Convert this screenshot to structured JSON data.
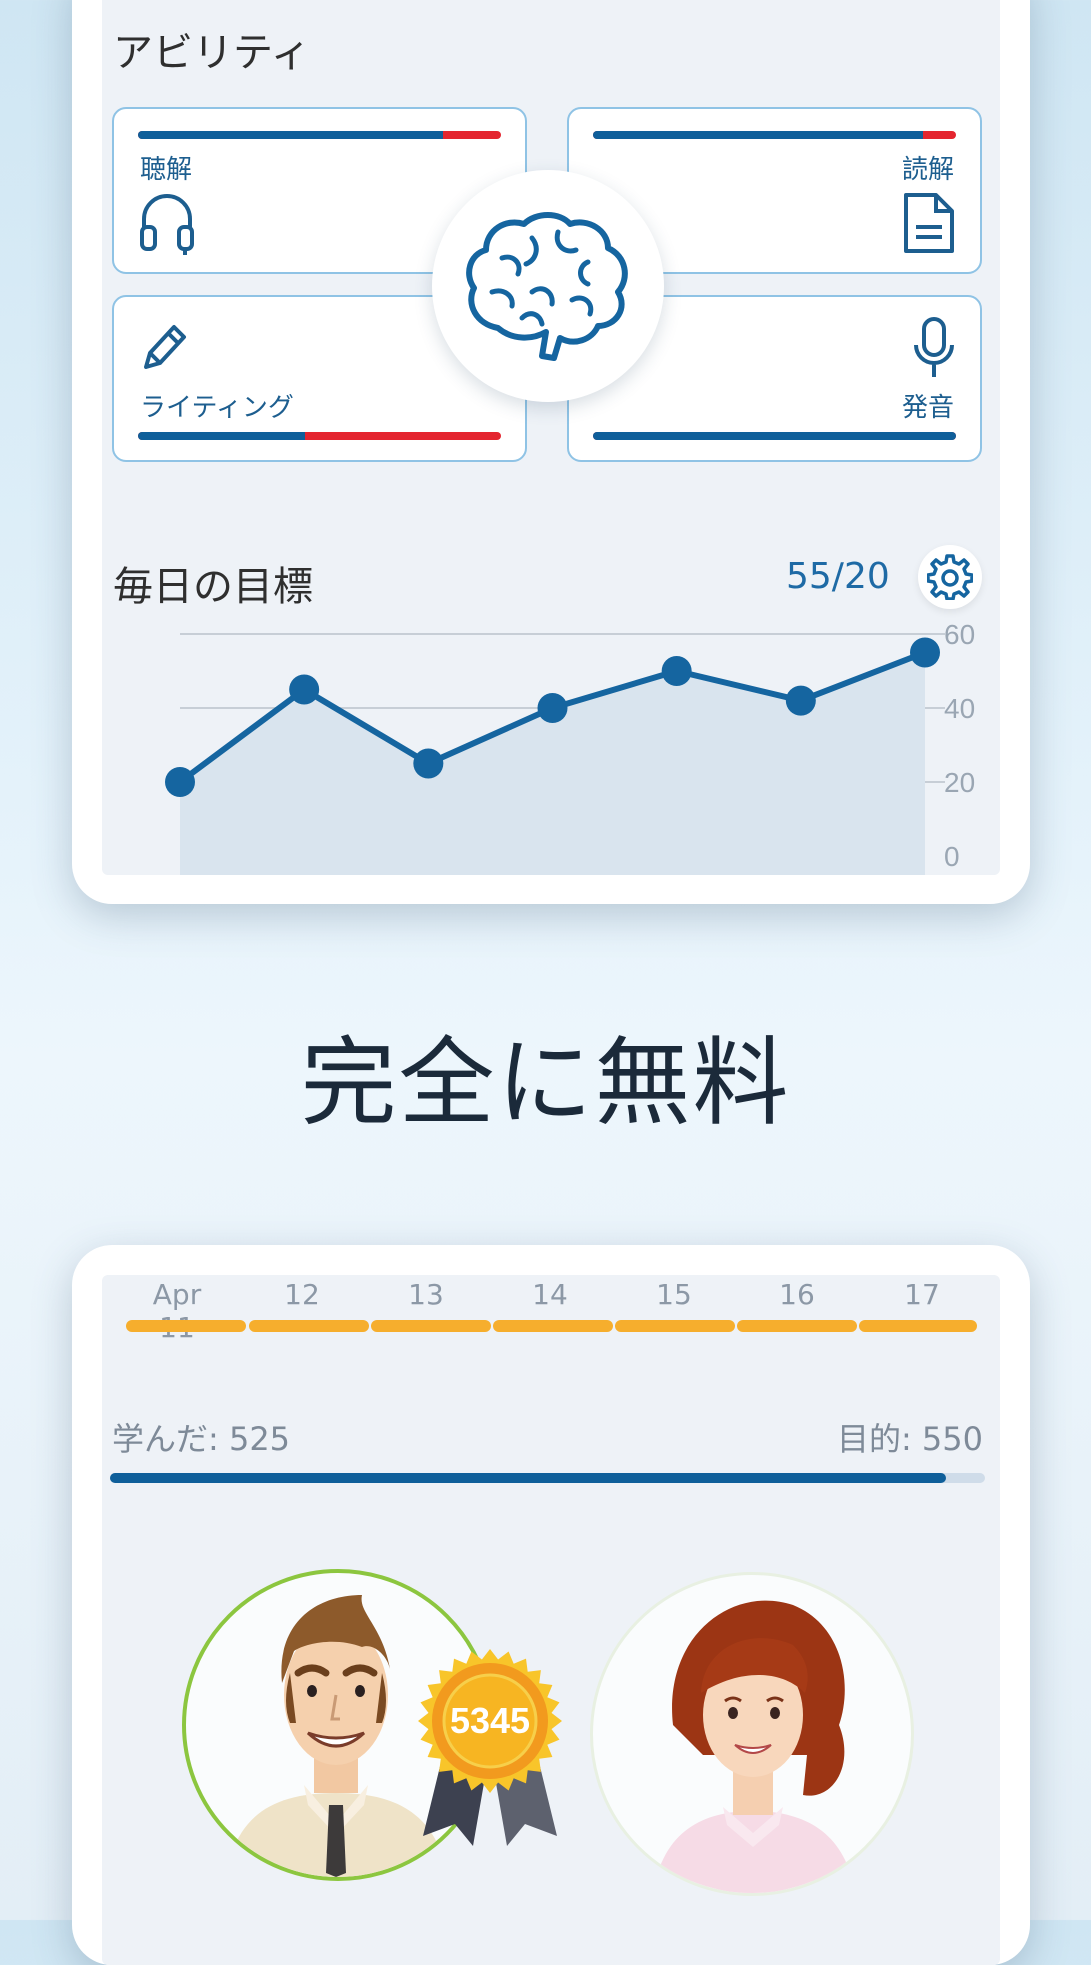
{
  "ability": {
    "title": "アビリティ",
    "skills": [
      {
        "label": "聴解",
        "progress": 0.84,
        "icon": "headphones-icon"
      },
      {
        "label": "読解",
        "progress": 0.91,
        "icon": "document-icon"
      },
      {
        "label": "ライティング",
        "progress": 0.46,
        "icon": "pencil-icon"
      },
      {
        "label": "発音",
        "progress": 1.0,
        "icon": "microphone-icon"
      }
    ],
    "center_icon": "brain-icon"
  },
  "daily_goal": {
    "title": "毎日の目標",
    "value": "55/20",
    "settings_icon": "gear-icon"
  },
  "chart_data": {
    "type": "area",
    "x": [
      1,
      2,
      3,
      4,
      5,
      6,
      7
    ],
    "values": [
      20,
      45,
      25,
      40,
      50,
      42,
      55
    ],
    "y_ticks": [
      "60",
      "40",
      "20",
      "0"
    ],
    "ylim": [
      0,
      60
    ],
    "grid": true,
    "colors": {
      "line": "#1565a0",
      "fill": "#d9e4ee"
    }
  },
  "hero": {
    "text": "完全に無料"
  },
  "calendar": {
    "dates": [
      "Apr 11",
      "12",
      "13",
      "14",
      "15",
      "16",
      "17"
    ],
    "streak_color": "#f6ae2d"
  },
  "progress": {
    "learned": "学んだ: 525",
    "goal": "目的: 550",
    "fraction": 0.955
  },
  "leaderboard": {
    "badge_score": "5345",
    "avatars": [
      "male-avatar",
      "female-avatar"
    ]
  },
  "colors": {
    "accent": "#0f5f9a",
    "alert": "#e4252f",
    "streak": "#f6ae2d",
    "green_ring": "#8cc63f"
  }
}
